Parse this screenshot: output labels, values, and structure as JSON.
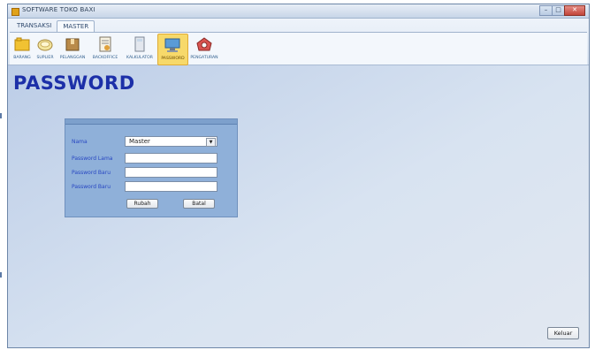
{
  "window": {
    "title": "SOFTWARE TOKO BAXI"
  },
  "ribbon": {
    "tabs": [
      {
        "label": "TRANSAKSI",
        "active": false
      },
      {
        "label": "MASTER",
        "active": true
      }
    ],
    "buttons": [
      {
        "label": "BARANG",
        "icon": "folder-icon",
        "active": false
      },
      {
        "label": "SUPLIER",
        "icon": "disk-icon",
        "active": false
      },
      {
        "label": "PELANGGAN",
        "icon": "box-icon",
        "active": false
      },
      {
        "label": "BACKOFFICE",
        "icon": "document-icon",
        "active": false
      },
      {
        "label": "KALKULATOR",
        "icon": "calculator-icon",
        "active": false
      },
      {
        "label": "PASSWORD",
        "icon": "monitor-icon",
        "active": true
      },
      {
        "label": "PENGATURAN",
        "icon": "settings-icon",
        "active": false
      }
    ]
  },
  "page": {
    "title": "PASSWORD"
  },
  "form": {
    "nama_label": "Nama",
    "nama_value": "Master",
    "old_password_label": "Password Lama",
    "new_password_label": "Password Baru",
    "confirm_password_label": "Password Baru",
    "old_password_value": "",
    "new_password_value": "",
    "confirm_password_value": "",
    "rubah_label": "Rubah",
    "batal_label": "Batal"
  },
  "footer": {
    "keluar_label": "Keluar"
  },
  "colors": {
    "title": "#1c2fa8",
    "label": "#2746c2",
    "panel": "#8fb0d9",
    "active_button": "#f7d96a"
  }
}
